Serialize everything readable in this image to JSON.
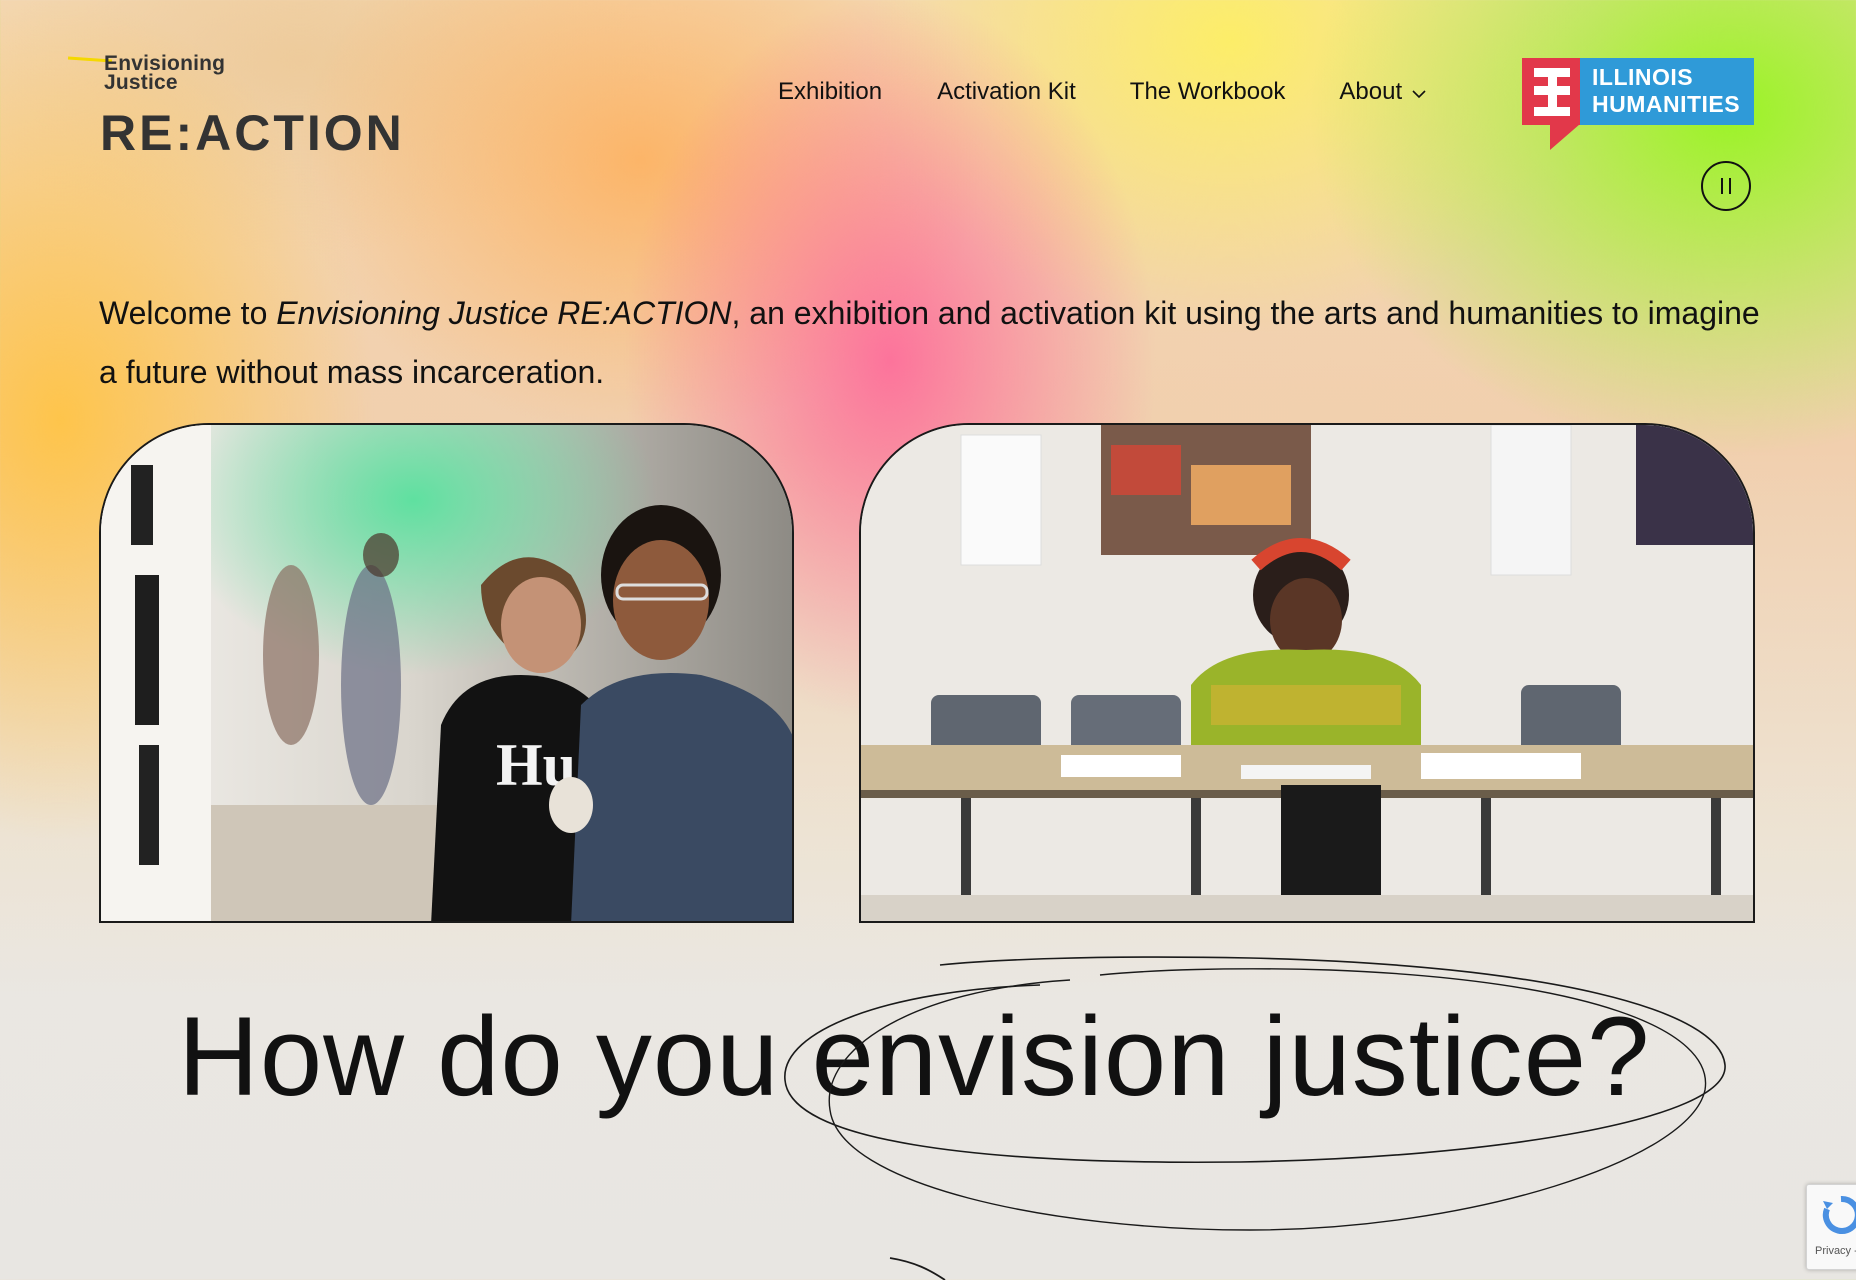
{
  "brand": {
    "line1": "Envisioning",
    "line2": "Justice",
    "main": "RE:ACTION"
  },
  "nav": {
    "items": [
      "Exhibition",
      "Activation Kit",
      "The Workbook",
      "About"
    ]
  },
  "partner_logo": {
    "line1": "ILLINOIS",
    "line2": "HUMANITIES",
    "colors": {
      "blue": "#2f9ad8",
      "red": "#e2384a"
    }
  },
  "intro": {
    "prefix": "Welcome to ",
    "title": "Envisioning Justice RE:ACTION",
    "suffix": ", an exhibition and activation kit using the arts and humanities to imagine a future without mass incarceration."
  },
  "headline": "How do you envision justice?",
  "recaptcha": {
    "label": "Privacy -"
  },
  "icons": {
    "pause": "pause-icon",
    "chevron": "chevron-down-icon"
  }
}
